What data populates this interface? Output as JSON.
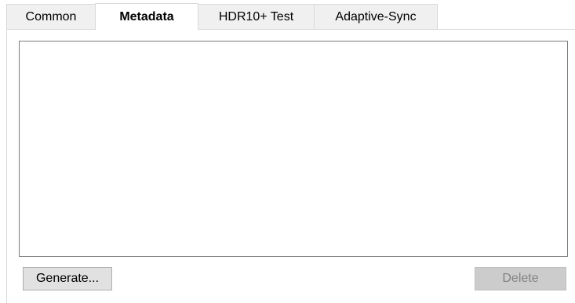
{
  "tabs": [
    {
      "label": "Common",
      "active": false
    },
    {
      "label": "Metadata",
      "active": true
    },
    {
      "label": "HDR10+ Test",
      "active": false
    },
    {
      "label": "Adaptive-Sync",
      "active": false
    }
  ],
  "metadata_panel": {
    "list_items": [],
    "generate_label": "Generate...",
    "delete_label": "Delete",
    "delete_enabled": false
  }
}
